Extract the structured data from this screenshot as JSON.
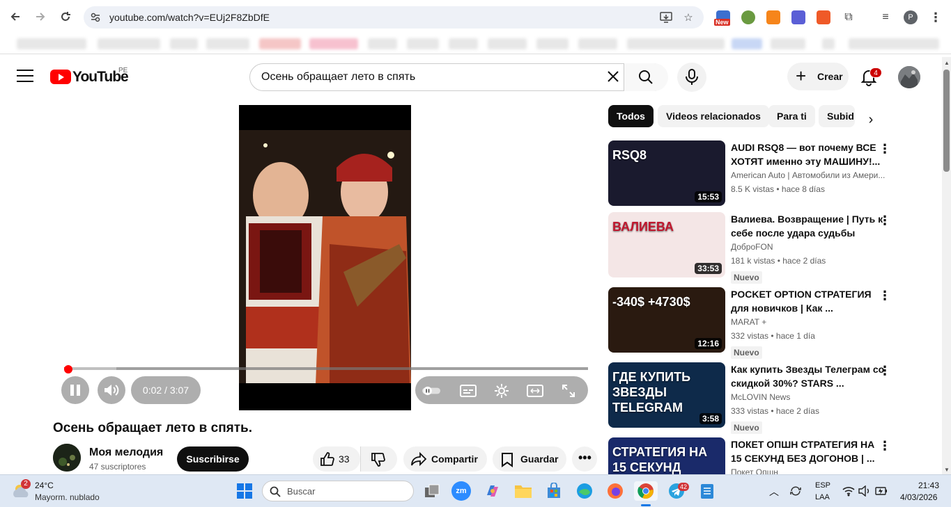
{
  "browser": {
    "url": "youtube.com/watch?v=EUj2F8ZbDfE",
    "new_badge": "New",
    "profile_initial": "P"
  },
  "header": {
    "logo_text": "YouTube",
    "region": "PE",
    "search_value": "Осень обращает лето в спять",
    "create_label": "Crear",
    "notification_count": "4"
  },
  "player": {
    "time": "0:02 / 3:07",
    "progress": 0.003,
    "buffered": 0.1
  },
  "video": {
    "title": "Осень обращает лето в спять.",
    "channel": "Моя мелодия",
    "subscribers": "47 suscriptores",
    "subscribe_label": "Suscribirse",
    "likes": "33",
    "share_label": "Compartir",
    "save_label": "Guardar"
  },
  "chips": [
    "Todos",
    "Videos relacionados",
    "Para ti",
    "Subid"
  ],
  "recommendations": [
    {
      "title": "AUDI RSQ8 — вот почему ВСЕ ХОТЯТ именно эту МАШИНУ!...",
      "channel": "American Auto | Автомобили из Амери...",
      "meta": "8.5 K vistas • hace 8 días",
      "duration": "15:53",
      "badge": "",
      "thumb_text": "RSQ8",
      "thumb_color": "#1a1a2e"
    },
    {
      "title": "Валиева. Возвращение | Путь к себе после удара судьбы",
      "channel": "ДоброFON",
      "meta": "181 k vistas • hace 2 días",
      "duration": "33:53",
      "badge": "Nuevo",
      "thumb_text": "ВАЛИЕВА",
      "thumb_color": "#f4e6e6"
    },
    {
      "title": "POCKET OPTION СТРАТЕГИЯ для новичков | Как ...",
      "channel": "MARAT +",
      "meta": "332 vistas • hace 1 día",
      "duration": "12:16",
      "badge": "Nuevo",
      "thumb_text": "-340$ +4730$",
      "thumb_color": "#2a1a10"
    },
    {
      "title": "Как купить Звезды Телеграм со скидкой 30%? STARS ...",
      "channel": "McLOVIN News",
      "meta": "333 vistas • hace 2 días",
      "duration": "3:58",
      "badge": "Nuevo",
      "thumb_text": "ГДЕ КУПИТЬ ЗВЕЗДЫ TELEGRAM",
      "thumb_color": "#0e2a4a"
    },
    {
      "title": "ПОКЕТ ОПШН СТРАТЕГИЯ НА 15 СЕКУНД БЕЗ ДОГОНОВ | ...",
      "channel": "Покет Опшн",
      "meta": "",
      "duration": "",
      "badge": "",
      "thumb_text": "СТРАТЕГИЯ НА 15 СЕКУНД",
      "thumb_color": "#1a2a6a"
    }
  ],
  "taskbar": {
    "weather_badge": "2",
    "temperature": "24°C",
    "weather_desc": "Mayorm. nublado",
    "search_label": "Buscar",
    "telegram_badge": "42",
    "lang": "ESP",
    "lang2": "LAA",
    "time": "21:43",
    "date": "4/03/2026"
  },
  "colors": {
    "accent": "#ff0000",
    "dark": "#0f0f0f"
  }
}
